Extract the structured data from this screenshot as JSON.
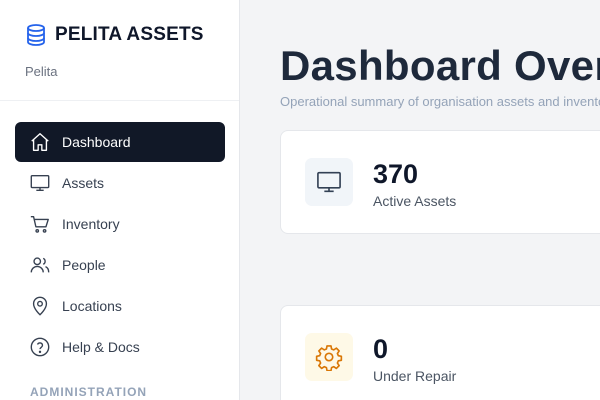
{
  "brand": {
    "title": "PELITA ASSETS",
    "subtitle": "Pelita",
    "icon": "database-icon",
    "accent": "#2563eb"
  },
  "sidebar": {
    "items": [
      {
        "label": "Dashboard",
        "icon": "home-icon",
        "active": true
      },
      {
        "label": "Assets",
        "icon": "monitor-icon"
      },
      {
        "label": "Inventory",
        "icon": "cart-icon"
      },
      {
        "label": "People",
        "icon": "users-icon"
      },
      {
        "label": "Locations",
        "icon": "map-pin-icon"
      },
      {
        "label": "Help & Docs",
        "icon": "help-circle-icon"
      }
    ],
    "section_label": "ADMINISTRATION"
  },
  "main": {
    "title": "Dashboard Overview",
    "subtitle": "Operational summary of organisation assets and inventory",
    "stats": [
      {
        "value": "370",
        "label": "Active Assets",
        "icon": "monitor-icon",
        "icon_bg": "#f1f5f9",
        "icon_color": "#334155"
      },
      {
        "value": "0",
        "label": "Under Repair",
        "icon": "gear-icon",
        "icon_bg": "#fef9e7",
        "icon_color": "#d97706"
      }
    ]
  },
  "colors": {
    "active_nav_bg": "#111827",
    "page_bg": "#f3f4f6"
  }
}
